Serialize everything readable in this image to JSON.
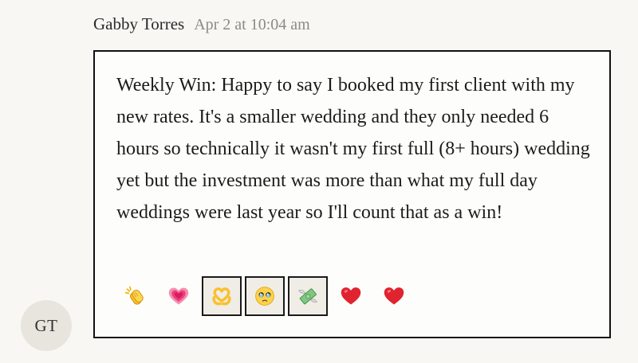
{
  "message": {
    "author": "Gabby Torres",
    "timestamp": "Apr 2 at 10:04 am",
    "avatar_initials": "GT",
    "body": "Weekly Win: Happy to say I booked my first client with my new rates. It's a smaller wedding and they only needed 6 hours so technically it wasn't my first full (8+ hours) wedding yet but the investment was more than what my full day weddings were last year so I'll count that as a win!",
    "reactions": [
      {
        "icon": "clapping-hands-icon",
        "selected": false
      },
      {
        "icon": "growing-heart-icon",
        "selected": false
      },
      {
        "icon": "heart-hands-icon",
        "selected": true
      },
      {
        "icon": "holding-back-tears-face-icon",
        "selected": true
      },
      {
        "icon": "money-with-wings-icon",
        "selected": true
      },
      {
        "icon": "red-heart-icon",
        "selected": false
      },
      {
        "icon": "red-heart-icon",
        "selected": false
      }
    ]
  },
  "colors": {
    "background": "#f8f7f3",
    "box_border": "#111111",
    "timestamp": "#8a8a86",
    "avatar_bg": "#e7e5de",
    "heart_red": "#e0242f",
    "pink_heart": "#f0579a",
    "emoji_yellow": "#fbc02d"
  }
}
